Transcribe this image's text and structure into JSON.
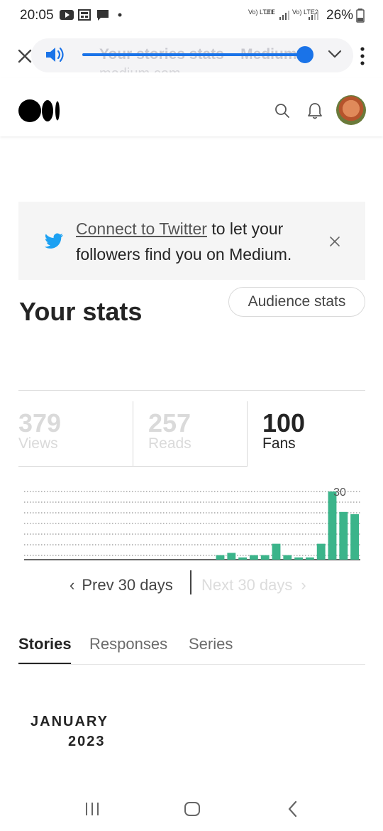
{
  "status_bar": {
    "time": "20:05",
    "sim1": "Vo) LTE1",
    "lte": "LTE",
    "sim2": "Vo) LTE2",
    "battery": "26%"
  },
  "browser": {
    "page_title": "Your stories stats – Medium",
    "domain": "medium.com",
    "volume_level": 0.95,
    "accent_color": "#1a73e8"
  },
  "header": {
    "icons": [
      "medium-logo",
      "search-icon",
      "bell-icon",
      "avatar"
    ]
  },
  "twitter_banner": {
    "link_text": "Connect to Twitter",
    "rest_text": " to let your followers find you on Medium.",
    "icon_color": "#1da1f2"
  },
  "stats": {
    "title": "Your stats",
    "audience_button": "Audience stats"
  },
  "metrics": [
    {
      "value": "379",
      "label": "Views",
      "active": false
    },
    {
      "value": "257",
      "label": "Reads",
      "active": false
    },
    {
      "value": "100",
      "label": "Fans",
      "active": true
    }
  ],
  "chart_data": {
    "type": "bar",
    "series": [
      {
        "values": [
          0,
          0,
          0,
          0,
          0,
          0,
          0,
          0,
          0,
          0,
          0,
          0,
          0,
          0,
          0,
          0,
          0,
          2,
          3,
          1,
          2,
          2,
          7,
          2,
          1,
          1,
          7,
          30,
          21,
          20
        ]
      }
    ],
    "max_label": "30",
    "ylim": [
      0,
      30
    ],
    "grid": true,
    "bar_color": "#3bb48a"
  },
  "pager": {
    "prev": "Prev 30 days",
    "next": "Next 30 days"
  },
  "tabs": [
    {
      "label": "Stories",
      "active": true
    },
    {
      "label": "Responses",
      "active": false
    },
    {
      "label": "Series",
      "active": false
    }
  ],
  "month": {
    "name": "JANUARY",
    "year": "2023"
  }
}
